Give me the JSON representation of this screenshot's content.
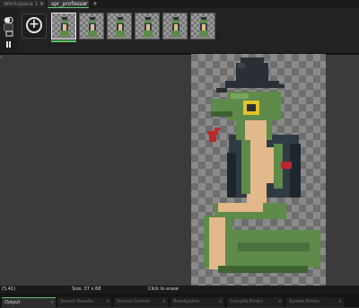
{
  "tabs": [
    {
      "label": "Workspace 1",
      "close": "×"
    },
    {
      "label": "spr_professor",
      "close": "×"
    }
  ],
  "tab_add": "+",
  "toolbar": {
    "add_frame_symbol": "+"
  },
  "frames_count_visible": 6,
  "selected_frame_index": 0,
  "status": {
    "coords": "(5,41)",
    "size": "Size: 37 x 68",
    "hint": "Click to erase"
  },
  "bottom_tabs": [
    {
      "label": "Output",
      "close": "×"
    },
    {
      "label": "Search Results",
      "close": "×"
    },
    {
      "label": "Source Control",
      "close": "×"
    },
    {
      "label": "Breakpoints",
      "close": "×"
    },
    {
      "label": "Compile Errors",
      "close": "×"
    },
    {
      "label": "Syntax Errors",
      "close": "×"
    }
  ],
  "colors": {
    "accent": "#5cc46b",
    "snake_green": "#5e8a4a",
    "belly": "#e2b98a",
    "coat": "#2f3a45",
    "hat": "#2a2f36",
    "monocle": "#e3c22a",
    "red": "#c0262d"
  }
}
